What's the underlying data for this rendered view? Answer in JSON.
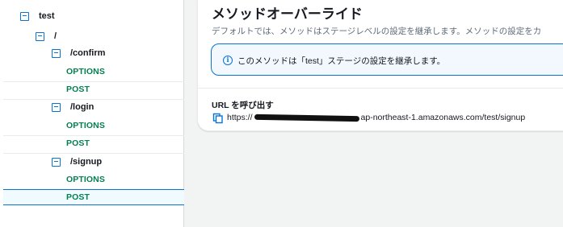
{
  "tree": {
    "stage": "test",
    "root": "/",
    "resources": [
      {
        "path": "/confirm",
        "methods": [
          "OPTIONS",
          "POST"
        ]
      },
      {
        "path": "/login",
        "methods": [
          "OPTIONS",
          "POST"
        ]
      },
      {
        "path": "/signup",
        "methods": [
          "OPTIONS",
          "POST"
        ]
      }
    ],
    "selected": "/signup POST"
  },
  "panel": {
    "title": "メソッドオーバーライド",
    "description": "デフォルトでは、メソッドはステージレベルの設定を継承します。メソッドの設定をカ",
    "info_text": "このメソッドは「test」ステージの設定を継承します。",
    "info_icon": "i",
    "invoke_url_label": "URL を呼び出す",
    "invoke_url_prefix": "https://",
    "invoke_url_suffix": "ap-northeast-1.amazonaws.com/test/signup"
  },
  "colors": {
    "accent": "#0972d3",
    "method": "#037f51",
    "selected_bg": "#f0fbff"
  }
}
